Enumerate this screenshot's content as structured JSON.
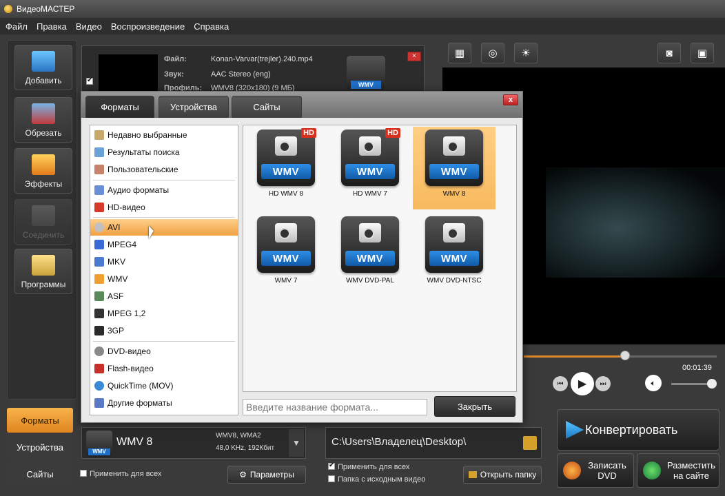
{
  "window": {
    "title": "ВидеоМАСТЕР"
  },
  "menu": [
    "Файл",
    "Правка",
    "Видео",
    "Воспроизведение",
    "Справка"
  ],
  "left_tools": [
    {
      "label": "Добавить",
      "icon": "film-add-icon",
      "enabled": true
    },
    {
      "label": "Обрезать",
      "icon": "scissors-icon",
      "enabled": true
    },
    {
      "label": "Эффекты",
      "icon": "star-sparkle-icon",
      "enabled": true
    },
    {
      "label": "Соединить",
      "icon": "join-icon",
      "enabled": false
    },
    {
      "label": "Программы",
      "icon": "tags-icon",
      "enabled": true
    }
  ],
  "file_info": {
    "file_key": "Файл:",
    "file_val": "Konan-Varvar(trejler).240.mp4",
    "sound_key": "Звук:",
    "sound_val": "AAC Stereo (eng)",
    "profile_key": "Профиль:",
    "profile_val": "WMV8 (320x180) (9 МБ)",
    "badge": "WMV"
  },
  "preview": {
    "time": "00:01:39",
    "progress": 0.52,
    "volume": 0.92
  },
  "bottom_tabs": [
    "Форматы",
    "Устройства",
    "Сайты"
  ],
  "format_summary": {
    "name": "WMV 8",
    "codec": "WMV8, WMA2",
    "audio": "48,0 KHz, 192Кбит",
    "apply_all": "Применить для всех",
    "params": "Параметры",
    "badge": "WMV"
  },
  "output": {
    "path": "C:\\Users\\Владелец\\Desktop\\",
    "apply_all": "Применить для всех",
    "source_folder": "Папка с исходным видео",
    "open_folder": "Открыть папку"
  },
  "actions": {
    "convert": "Конвертировать",
    "burn_dvd": "Записать DVD",
    "publish": "Разместить на сайте"
  },
  "dialog": {
    "tabs": [
      "Форматы",
      "Устройства",
      "Сайты"
    ],
    "close_x": "x",
    "categories": [
      {
        "label": "Недавно выбранные",
        "icon": "recent-icon",
        "color": "#c9a86b"
      },
      {
        "label": "Результаты поиска",
        "icon": "search-icon",
        "color": "#6ba2d6"
      },
      {
        "label": "Пользовательские",
        "icon": "user-icon",
        "color": "#c8826b"
      },
      {
        "label": "Аудио форматы",
        "icon": "music-note-icon",
        "color": "#6b8fd6"
      },
      {
        "label": "HD-видео",
        "icon": "hd-icon",
        "color": "#d63a2a"
      },
      {
        "label": "AVI",
        "icon": "disc-icon",
        "color": "#c0c0c0"
      },
      {
        "label": "MPEG4",
        "icon": "mp4-icon",
        "color": "#3a6ad6"
      },
      {
        "label": "MKV",
        "icon": "mkv-icon",
        "color": "#4a7bd0"
      },
      {
        "label": "WMV",
        "icon": "wmv-icon",
        "color": "#f0a030"
      },
      {
        "label": "ASF",
        "icon": "asf-icon",
        "color": "#5a8a5a"
      },
      {
        "label": "MPEG 1,2",
        "icon": "mpeg-icon",
        "color": "#333333"
      },
      {
        "label": "3GP",
        "icon": "phone-icon",
        "color": "#2a2a2a"
      },
      {
        "label": "DVD-видео",
        "icon": "dvd-icon",
        "color": "#888888"
      },
      {
        "label": "Flash-видео",
        "icon": "flash-icon",
        "color": "#c8302a"
      },
      {
        "label": "QuickTime (MOV)",
        "icon": "quicktime-icon",
        "color": "#3a8ad6"
      },
      {
        "label": "Другие форматы",
        "icon": "other-formats-icon",
        "color": "#5a7ac6"
      }
    ],
    "selected_category": "AVI",
    "formats": [
      {
        "label": "HD WMV 8",
        "badge": "WMV",
        "hd": "HD",
        "selected": false
      },
      {
        "label": "HD WMV 7",
        "badge": "WMV",
        "hd": "HD",
        "selected": false
      },
      {
        "label": "WMV 8",
        "badge": "WMV",
        "hd": "",
        "selected": true
      },
      {
        "label": "WMV 7",
        "badge": "WMV",
        "hd": "",
        "selected": false
      },
      {
        "label": "WMV DVD-PAL",
        "badge": "WMV",
        "hd": "",
        "selected": false
      },
      {
        "label": "WMV DVD-NTSC",
        "badge": "WMV",
        "hd": "",
        "selected": false
      }
    ],
    "search_placeholder": "Введите название формата...",
    "close_button": "Закрыть"
  },
  "colors": {
    "accent": "#f0a042",
    "wmv_blue": "#1f6fc8",
    "close_red": "#cc3333"
  }
}
